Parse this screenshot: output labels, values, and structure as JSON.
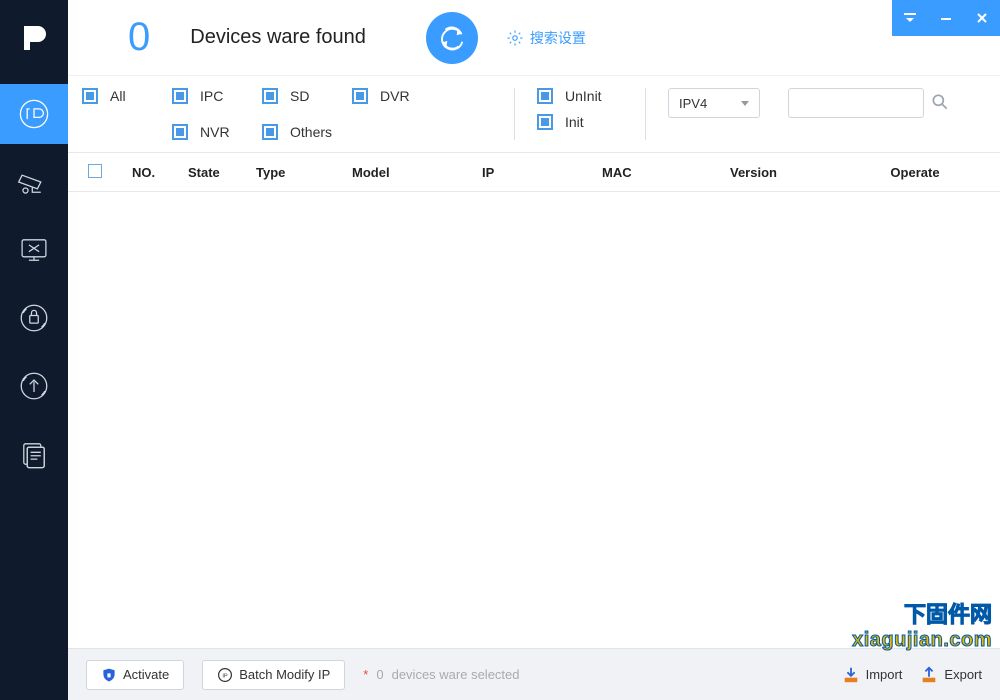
{
  "header": {
    "device_count": "0",
    "title": "Devices ware found",
    "settings_label": "搜索设置"
  },
  "filters": {
    "all": "All",
    "ipc": "IPC",
    "sd": "SD",
    "dvr": "DVR",
    "nvr": "NVR",
    "others": "Others",
    "uninit": "UnInit",
    "init": "Init"
  },
  "ip_version": {
    "selected": "IPV4"
  },
  "search": {
    "value": ""
  },
  "table": {
    "headers": {
      "no": "NO.",
      "state": "State",
      "type": "Type",
      "model": "Model",
      "ip": "IP",
      "mac": "MAC",
      "version": "Version",
      "operate": "Operate"
    }
  },
  "footer": {
    "activate": "Activate",
    "batch_modify": "Batch Modify IP",
    "selected_count": "0",
    "selected_label": "devices ware selected",
    "import": "Import",
    "export": "Export"
  },
  "watermark": {
    "line1": "下固件网",
    "line2": "xiagujian.com"
  }
}
